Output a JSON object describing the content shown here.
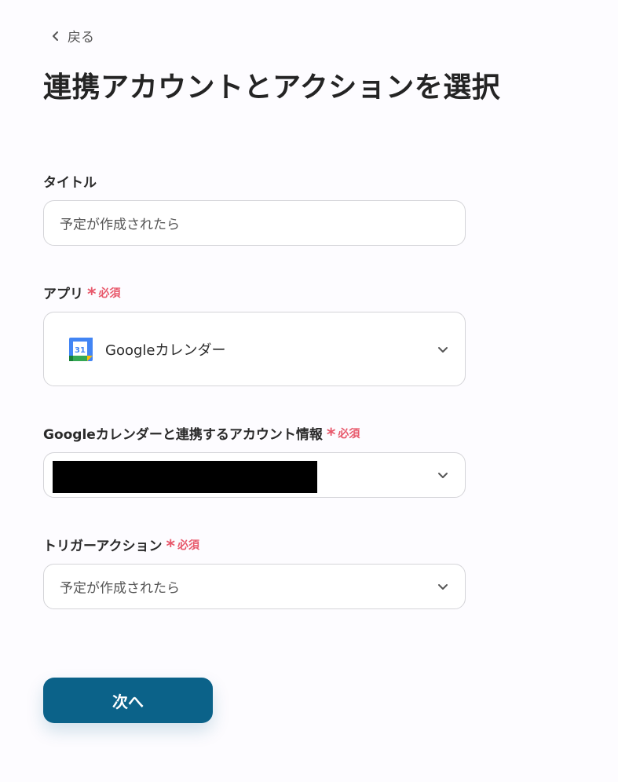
{
  "nav": {
    "back_label": "戻る"
  },
  "page": {
    "title": "連携アカウントとアクションを選択"
  },
  "required_mark": {
    "star": "*",
    "text": "必須"
  },
  "fields": {
    "title": {
      "label": "タイトル",
      "value": "予定が作成されたら"
    },
    "app": {
      "label": "アプリ",
      "value": "Googleカレンダー",
      "icon": "google-calendar-icon"
    },
    "account": {
      "label": "Googleカレンダーと連携するアカウント情報",
      "value": ""
    },
    "trigger": {
      "label": "トリガーアクション",
      "value": "予定が作成されたら"
    }
  },
  "buttons": {
    "next_label": "次へ"
  },
  "colors": {
    "primary": "#0b6289",
    "required": "#e8586b",
    "border": "#d4d4d8"
  }
}
